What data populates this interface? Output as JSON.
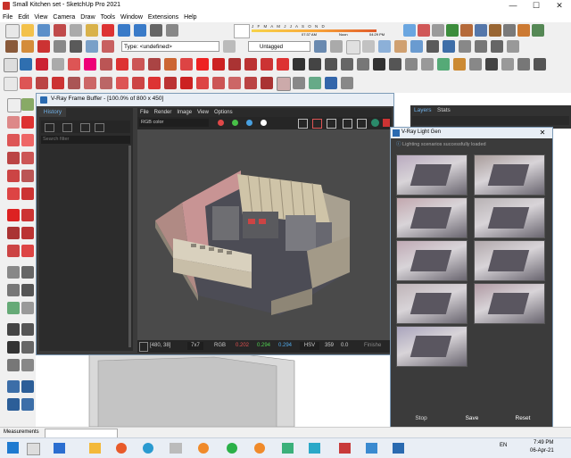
{
  "window": {
    "title": "Small Kitchen set - SketchUp Pro 2021",
    "minimize": "—",
    "maximize": "☐",
    "close": "✕"
  },
  "menu": [
    "File",
    "Edit",
    "View",
    "Camera",
    "Draw",
    "Tools",
    "Window",
    "Extensions",
    "Help"
  ],
  "shadow": {
    "months": "J F M A M J J A S O N D",
    "time_start": "07:37 AM",
    "noon": "Noon",
    "time_end": "04:29 PM"
  },
  "style_select": "Type: <undefined>",
  "layer_select": "Untagged",
  "vfb": {
    "title": "V-Ray Frame Buffer - [100.0% of 800 x 450]",
    "history_tab": "History",
    "search_placeholder": "Search filter",
    "menu": [
      "File",
      "Render",
      "Image",
      "View",
      "Options"
    ],
    "channel": "RGB color",
    "coords": "[480, 38]",
    "zoom": "7x7",
    "color_mode": "RGB",
    "r": "0.202",
    "g": "0.294",
    "b": "0.294",
    "hsv": "HSV",
    "h": "359",
    "s": "0.0",
    "status": "Finishe"
  },
  "right_tabs": {
    "layers": "Layers",
    "stats": "Stats"
  },
  "lightgen": {
    "title": "V-Ray Light Gen",
    "status": "Lighting scenarios successfully loaded",
    "stop": "Stop",
    "save": "Save",
    "reset": "Reset",
    "thumb_colors": [
      "#b9aabf",
      "#a89c9a",
      "#c2a7ae",
      "#b8b2b4",
      "#bfa9b4",
      "#b1a8ab",
      "#bfb4b8",
      "#b09aa3",
      "#a9a4bc"
    ]
  },
  "status_bar": {
    "measurements": "Measurements"
  },
  "taskbar": {
    "time": "7:49 PM",
    "date": "06-Apr-21",
    "lang": "EN"
  }
}
